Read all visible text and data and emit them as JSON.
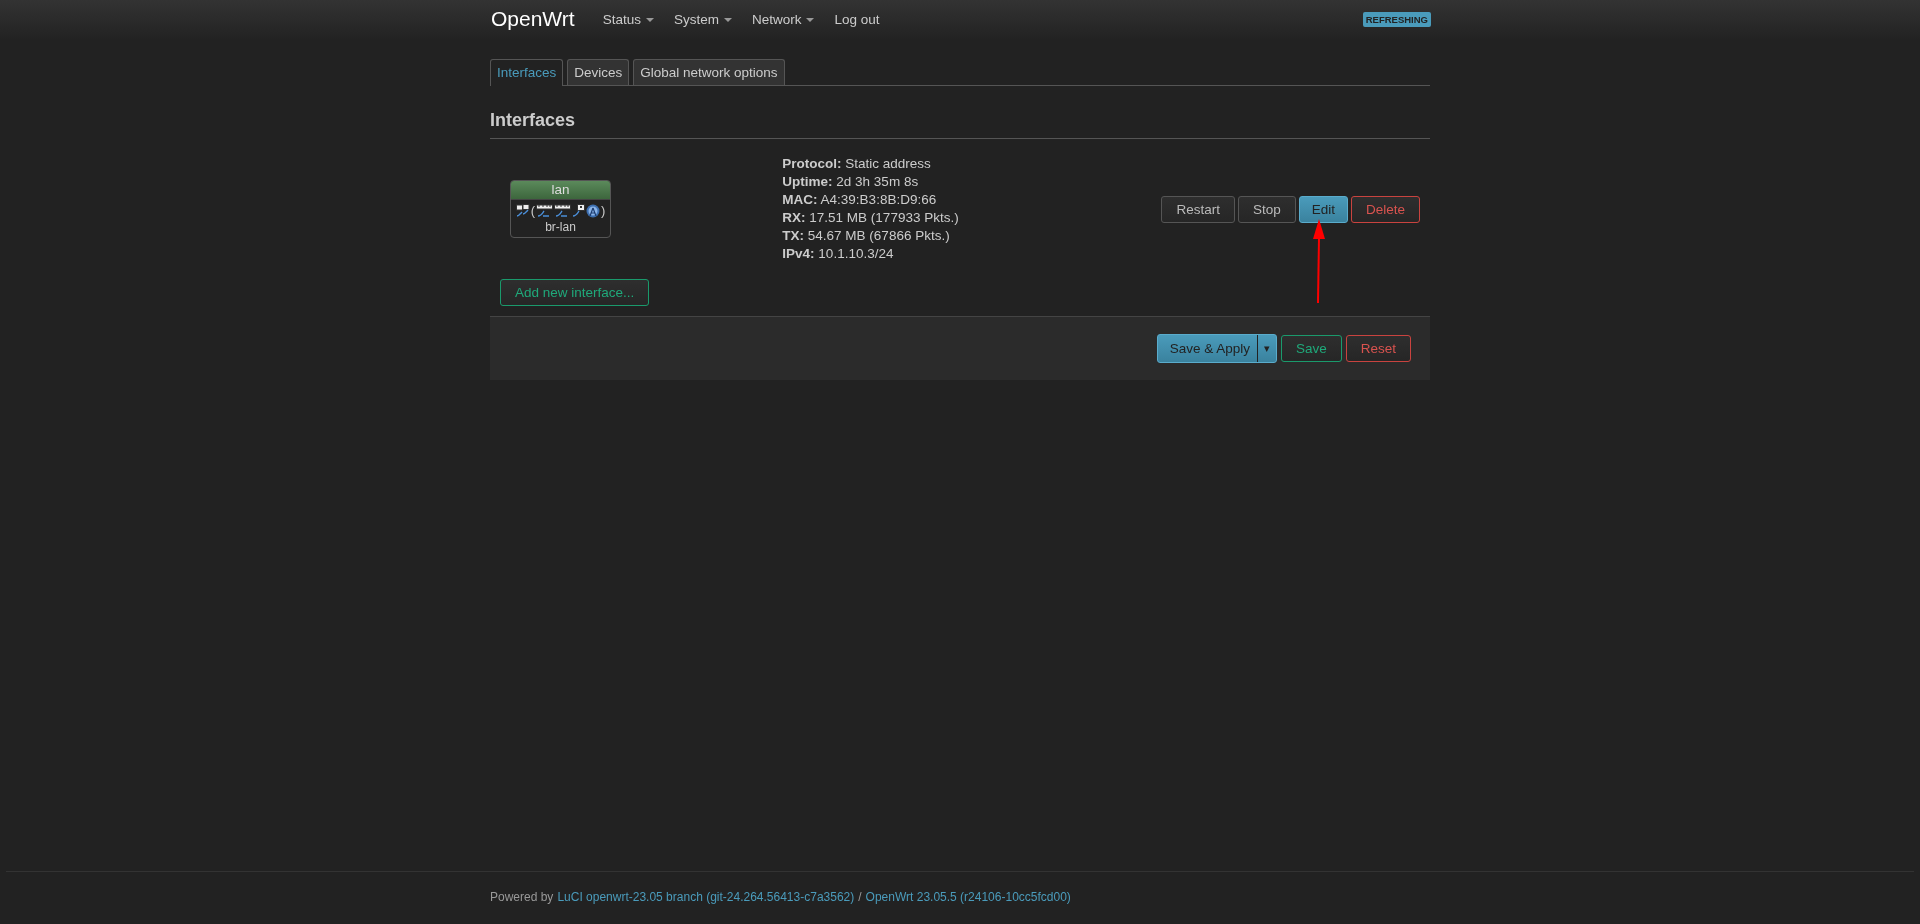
{
  "brand": "OpenWrt",
  "nav": [
    {
      "label": "Status",
      "dropdown": true
    },
    {
      "label": "System",
      "dropdown": true
    },
    {
      "label": "Network",
      "dropdown": true
    },
    {
      "label": "Log out",
      "dropdown": false
    }
  ],
  "indicator": "REFRESHING",
  "tabs": [
    {
      "label": "Interfaces",
      "selected": true
    },
    {
      "label": "Devices",
      "selected": false
    },
    {
      "label": "Global network options",
      "selected": false
    }
  ],
  "heading": "Interfaces",
  "interface": {
    "name": "lan",
    "device": "br-lan",
    "paren_open": "(",
    "paren_close": ")",
    "port_icons": [
      {
        "kind": "bridge"
      },
      {
        "kind": "switch"
      },
      {
        "kind": "switch"
      },
      {
        "kind": "port"
      },
      {
        "kind": "wireless"
      }
    ],
    "status": [
      {
        "label": "Protocol:",
        "value": "Static address"
      },
      {
        "label": "Uptime:",
        "value": "2d 3h 35m 8s"
      },
      {
        "label": "MAC:",
        "value": "A4:39:B3:8B:D9:66"
      },
      {
        "label": "RX:",
        "value": "17.51 MB (177933 Pkts.)"
      },
      {
        "label": "TX:",
        "value": "54.67 MB (67866 Pkts.)"
      },
      {
        "label": "IPv4:",
        "value": "10.1.10.3/24"
      }
    ],
    "buttons": [
      {
        "label": "Restart",
        "kind": "neutral"
      },
      {
        "label": "Stop",
        "kind": "neutral"
      },
      {
        "label": "Edit",
        "kind": "primary"
      },
      {
        "label": "Delete",
        "kind": "negative"
      }
    ]
  },
  "add_button": "Add new interface...",
  "actions": {
    "apply": "Save & Apply",
    "apply_menu": "▾",
    "save": "Save",
    "reset": "Reset"
  },
  "footer": {
    "prefix": "Powered by",
    "luci_link": "LuCI openwrt-23.05 branch (git-24.264.56413-c7a3562)",
    "separator": "/",
    "openwrt_link": "OpenWrt 23.05.5 (r24106-10cc5fcd00)"
  }
}
